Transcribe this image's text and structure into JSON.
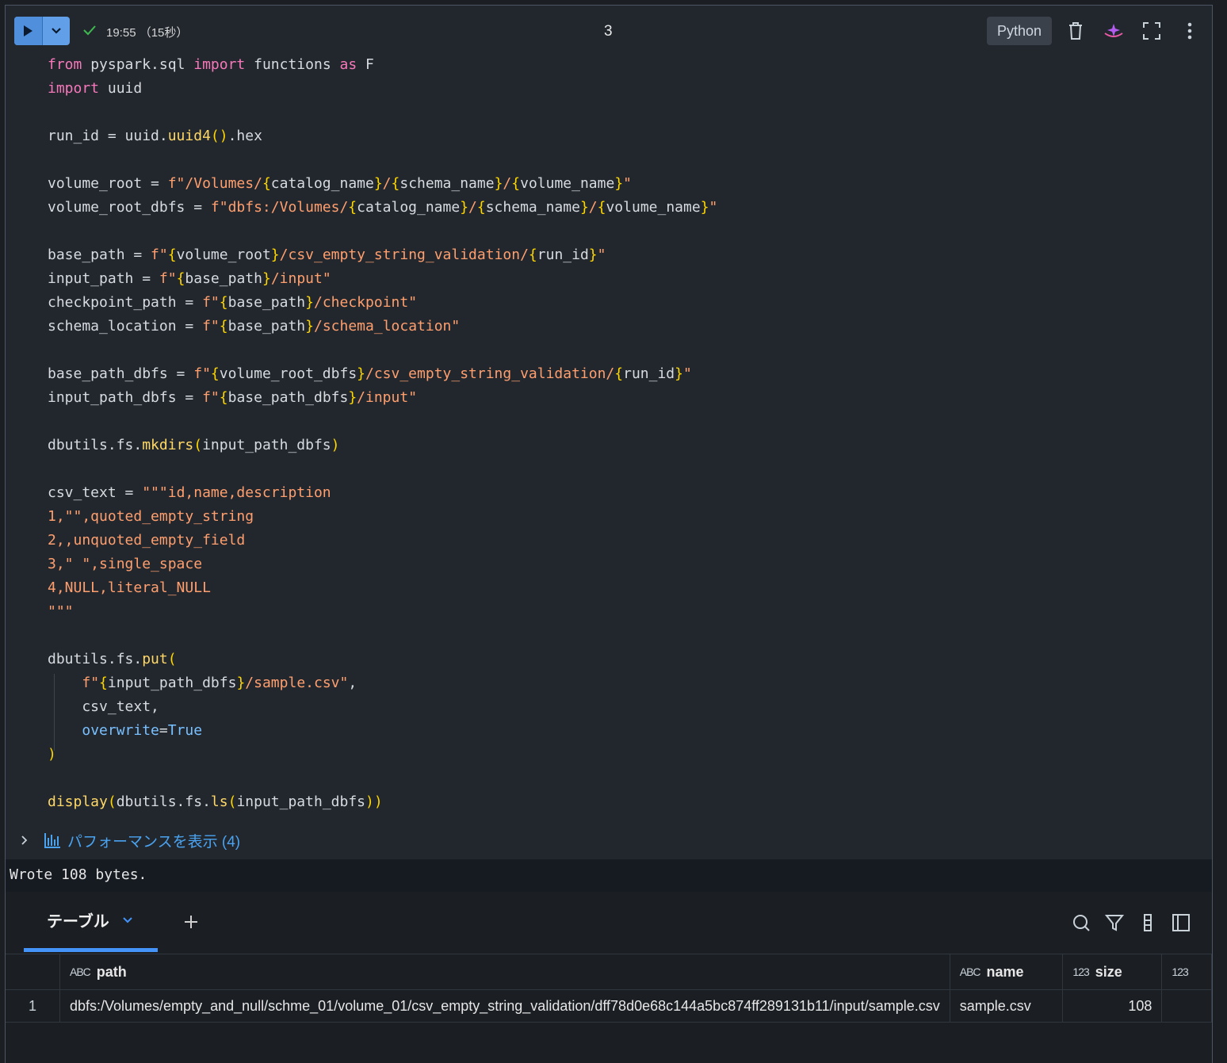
{
  "toolbar": {
    "run_status": "19:55 （15秒）",
    "cell_number": "3",
    "language": "Python",
    "icons": [
      "play-icon",
      "chevron-down-icon",
      "check-icon",
      "trash-icon",
      "assistant-icon",
      "fullscreen-icon",
      "more-vertical-icon"
    ],
    "accent_color": "#4f8fdc",
    "success_color": "#3fb950"
  },
  "code_lines": [
    [
      {
        "t": "kw",
        "v": "from"
      },
      {
        "t": "pl",
        "v": " pyspark.sql "
      },
      {
        "t": "kw",
        "v": "import"
      },
      {
        "t": "pl",
        "v": " functions "
      },
      {
        "t": "kw",
        "v": "as"
      },
      {
        "t": "pl",
        "v": " F"
      }
    ],
    [
      {
        "t": "kw",
        "v": "import"
      },
      {
        "t": "pl",
        "v": " uuid"
      }
    ],
    [],
    [
      {
        "t": "pl",
        "v": "run_id = uuid."
      },
      {
        "t": "fn",
        "v": "uuid4"
      },
      {
        "t": "br",
        "v": "()"
      },
      {
        "t": "pl",
        "v": ".hex"
      }
    ],
    [],
    [
      {
        "t": "pl",
        "v": "volume_root = "
      },
      {
        "t": "str",
        "v": "f\"/Volumes/"
      },
      {
        "t": "br",
        "v": "{"
      },
      {
        "t": "pl",
        "v": "catalog_name"
      },
      {
        "t": "br",
        "v": "}"
      },
      {
        "t": "str",
        "v": "/"
      },
      {
        "t": "br",
        "v": "{"
      },
      {
        "t": "pl",
        "v": "schema_name"
      },
      {
        "t": "br",
        "v": "}"
      },
      {
        "t": "str",
        "v": "/"
      },
      {
        "t": "br",
        "v": "{"
      },
      {
        "t": "pl",
        "v": "volume_name"
      },
      {
        "t": "br",
        "v": "}"
      },
      {
        "t": "str",
        "v": "\""
      }
    ],
    [
      {
        "t": "pl",
        "v": "volume_root_dbfs = "
      },
      {
        "t": "str",
        "v": "f\"dbfs:/Volumes/"
      },
      {
        "t": "br",
        "v": "{"
      },
      {
        "t": "pl",
        "v": "catalog_name"
      },
      {
        "t": "br",
        "v": "}"
      },
      {
        "t": "str",
        "v": "/"
      },
      {
        "t": "br",
        "v": "{"
      },
      {
        "t": "pl",
        "v": "schema_name"
      },
      {
        "t": "br",
        "v": "}"
      },
      {
        "t": "str",
        "v": "/"
      },
      {
        "t": "br",
        "v": "{"
      },
      {
        "t": "pl",
        "v": "volume_name"
      },
      {
        "t": "br",
        "v": "}"
      },
      {
        "t": "str",
        "v": "\""
      }
    ],
    [],
    [
      {
        "t": "pl",
        "v": "base_path = "
      },
      {
        "t": "str",
        "v": "f\""
      },
      {
        "t": "br",
        "v": "{"
      },
      {
        "t": "pl",
        "v": "volume_root"
      },
      {
        "t": "br",
        "v": "}"
      },
      {
        "t": "str",
        "v": "/csv_empty_string_validation/"
      },
      {
        "t": "br",
        "v": "{"
      },
      {
        "t": "pl",
        "v": "run_id"
      },
      {
        "t": "br",
        "v": "}"
      },
      {
        "t": "str",
        "v": "\""
      }
    ],
    [
      {
        "t": "pl",
        "v": "input_path = "
      },
      {
        "t": "str",
        "v": "f\""
      },
      {
        "t": "br",
        "v": "{"
      },
      {
        "t": "pl",
        "v": "base_path"
      },
      {
        "t": "br",
        "v": "}"
      },
      {
        "t": "str",
        "v": "/input\""
      }
    ],
    [
      {
        "t": "pl",
        "v": "checkpoint_path = "
      },
      {
        "t": "str",
        "v": "f\""
      },
      {
        "t": "br",
        "v": "{"
      },
      {
        "t": "pl",
        "v": "base_path"
      },
      {
        "t": "br",
        "v": "}"
      },
      {
        "t": "str",
        "v": "/checkpoint\""
      }
    ],
    [
      {
        "t": "pl",
        "v": "schema_location = "
      },
      {
        "t": "str",
        "v": "f\""
      },
      {
        "t": "br",
        "v": "{"
      },
      {
        "t": "pl",
        "v": "base_path"
      },
      {
        "t": "br",
        "v": "}"
      },
      {
        "t": "str",
        "v": "/schema_location\""
      }
    ],
    [],
    [
      {
        "t": "pl",
        "v": "base_path_dbfs = "
      },
      {
        "t": "str",
        "v": "f\""
      },
      {
        "t": "br",
        "v": "{"
      },
      {
        "t": "pl",
        "v": "volume_root_dbfs"
      },
      {
        "t": "br",
        "v": "}"
      },
      {
        "t": "str",
        "v": "/csv_empty_string_validation/"
      },
      {
        "t": "br",
        "v": "{"
      },
      {
        "t": "pl",
        "v": "run_id"
      },
      {
        "t": "br",
        "v": "}"
      },
      {
        "t": "str",
        "v": "\""
      }
    ],
    [
      {
        "t": "pl",
        "v": "input_path_dbfs = "
      },
      {
        "t": "str",
        "v": "f\""
      },
      {
        "t": "br",
        "v": "{"
      },
      {
        "t": "pl",
        "v": "base_path_dbfs"
      },
      {
        "t": "br",
        "v": "}"
      },
      {
        "t": "str",
        "v": "/input\""
      }
    ],
    [],
    [
      {
        "t": "pl",
        "v": "dbutils.fs."
      },
      {
        "t": "fn",
        "v": "mkdirs"
      },
      {
        "t": "br",
        "v": "("
      },
      {
        "t": "pl",
        "v": "input_path_dbfs"
      },
      {
        "t": "br",
        "v": ")"
      }
    ],
    [],
    [
      {
        "t": "pl",
        "v": "csv_text = "
      },
      {
        "t": "str",
        "v": "\"\"\"id,name,description"
      }
    ],
    [
      {
        "t": "str",
        "v": "1,\"\",quoted_empty_string"
      }
    ],
    [
      {
        "t": "str",
        "v": "2,,unquoted_empty_field"
      }
    ],
    [
      {
        "t": "str",
        "v": "3,\" \",single_space"
      }
    ],
    [
      {
        "t": "str",
        "v": "4,NULL,literal_NULL"
      }
    ],
    [
      {
        "t": "str",
        "v": "\"\"\""
      }
    ],
    [],
    [
      {
        "t": "pl",
        "v": "dbutils.fs."
      },
      {
        "t": "fn",
        "v": "put"
      },
      {
        "t": "br",
        "v": "("
      }
    ],
    [
      {
        "t": "pl",
        "v": "    "
      },
      {
        "t": "str",
        "v": "f\""
      },
      {
        "t": "br",
        "v": "{"
      },
      {
        "t": "pl",
        "v": "input_path_dbfs"
      },
      {
        "t": "br",
        "v": "}"
      },
      {
        "t": "str",
        "v": "/sample.csv\""
      },
      {
        "t": "pl",
        "v": ","
      }
    ],
    [
      {
        "t": "pl",
        "v": "    csv_text,"
      }
    ],
    [
      {
        "t": "pl",
        "v": "    "
      },
      {
        "t": "kwarg",
        "v": "overwrite"
      },
      {
        "t": "pl",
        "v": "="
      },
      {
        "t": "const",
        "v": "True"
      }
    ],
    [
      {
        "t": "br",
        "v": ")"
      }
    ],
    [],
    [
      {
        "t": "fn",
        "v": "display"
      },
      {
        "t": "br",
        "v": "("
      },
      {
        "t": "pl",
        "v": "dbutils.fs."
      },
      {
        "t": "fn",
        "v": "ls"
      },
      {
        "t": "br",
        "v": "("
      },
      {
        "t": "pl",
        "v": "input_path_dbfs"
      },
      {
        "t": "br",
        "v": "))"
      }
    ]
  ],
  "performance": {
    "label": "パフォーマンスを表示 (4)"
  },
  "stdout": "Wrote 108 bytes.",
  "results": {
    "tab_label": "テーブル",
    "add_label": "+",
    "columns": [
      {
        "type": "ABC",
        "name": "path"
      },
      {
        "type": "ABC",
        "name": "name"
      },
      {
        "type": "123",
        "name": "size"
      },
      {
        "type": "123",
        "name": ""
      }
    ],
    "rows": [
      {
        "index": "1",
        "path": "dbfs:/Volumes/empty_and_null/schme_01/volume_01/csv_empty_string_validation/dff78d0e68c144a5bc874ff289131b11/input/sample.csv",
        "name": "sample.csv",
        "size": "108"
      }
    ]
  }
}
